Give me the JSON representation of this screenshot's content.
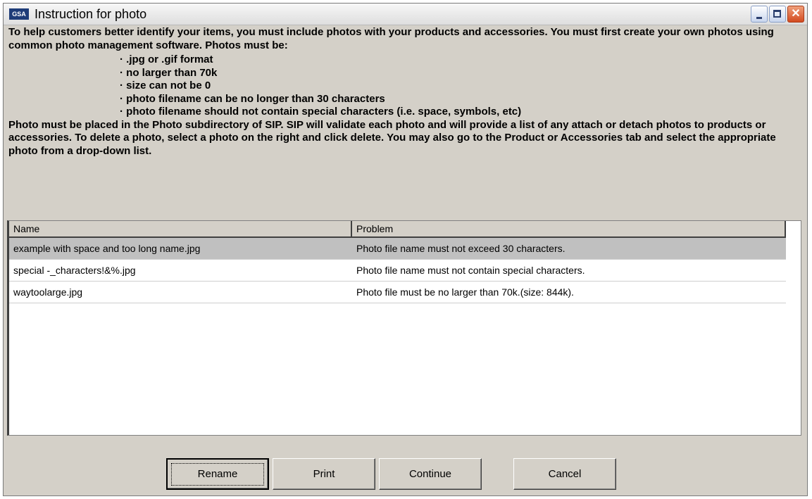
{
  "window": {
    "icon_text": "GSA",
    "title": "Instruction for photo"
  },
  "instructions": {
    "intro": "To help customers better identify your items, you must include photos with your products and accessories. You must first create your own photos using common photo management software. Photos must be:",
    "bullets": [
      "· .jpg or .gif format",
      "· no larger than 70k",
      "· size can not be 0",
      "· photo filename can be no longer than 30 characters",
      "· photo filename should not contain special characters (i.e. space, symbols, etc)"
    ],
    "outro": "Photo must be placed in the Photo subdirectory of SIP. SIP will validate each photo and will provide a list of any attach or detach photos to products or accessories. To delete a photo, select a photo on the right and click delete. You may also go to the Product or Accessories tab and select the appropriate photo from a drop-down list."
  },
  "table": {
    "columns": [
      "Name",
      "Problem"
    ],
    "rows": [
      {
        "name": "example with space and too long name.jpg",
        "problem": "Photo file name must not exceed 30 characters.",
        "selected": true
      },
      {
        "name": "special -_characters!&%.jpg",
        "problem": "Photo file name must not contain special characters.",
        "selected": false
      },
      {
        "name": "waytoolarge.jpg",
        "problem": "Photo file must be no larger than 70k.(size: 844k).",
        "selected": false
      }
    ]
  },
  "buttons": {
    "rename": "Rename",
    "print": "Print",
    "continue": "Continue",
    "cancel": "Cancel"
  }
}
